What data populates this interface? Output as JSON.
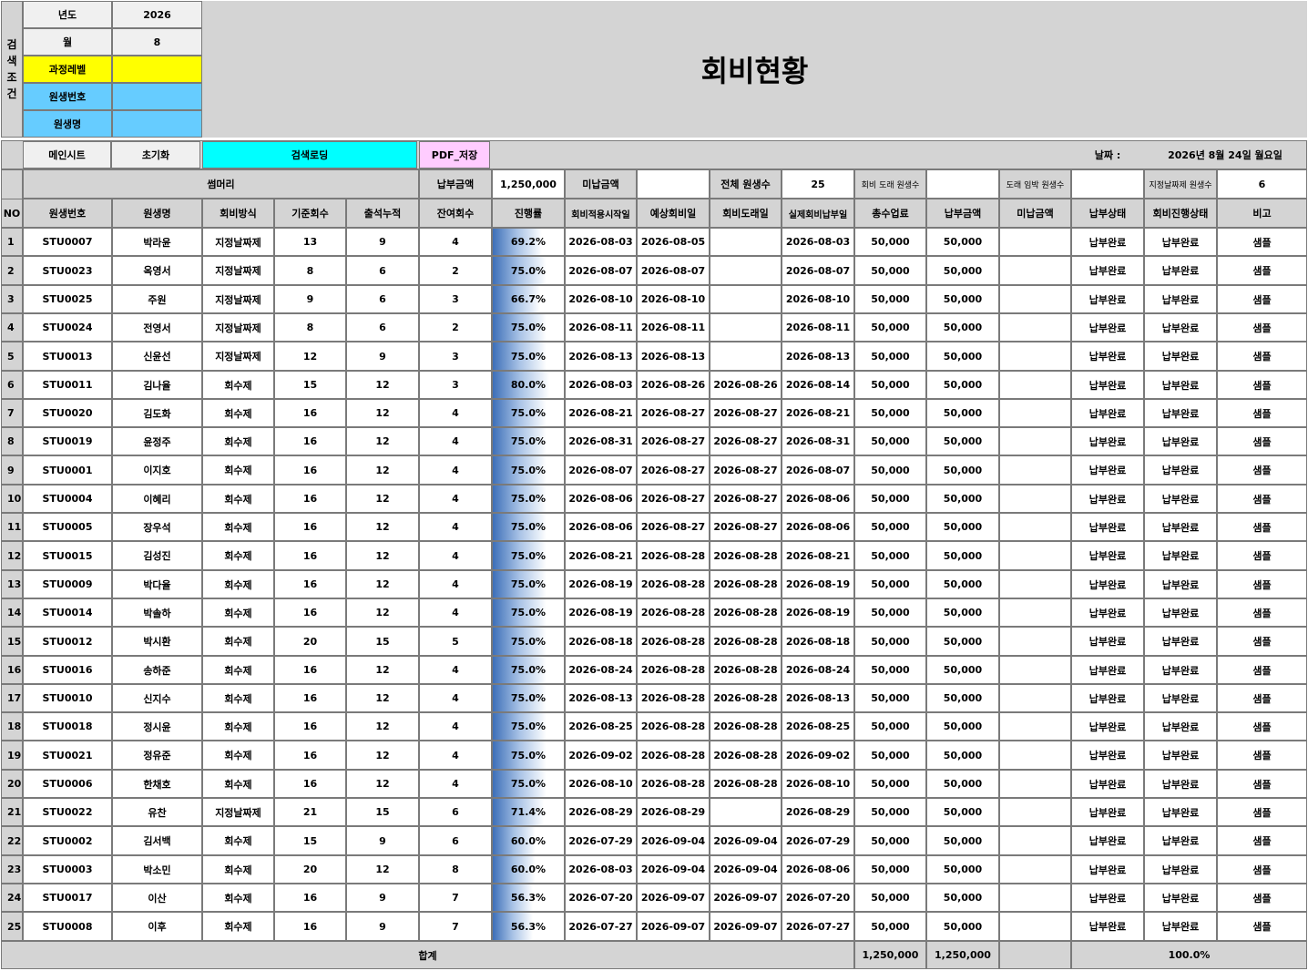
{
  "search": {
    "side_label": "검\n색\n조\n건",
    "year_label": "년도",
    "year_value": "2026",
    "month_label": "월",
    "month_value": "8",
    "level_label": "과정레벨",
    "level_value": "",
    "student_no_label": "원생번호",
    "student_no_value": "",
    "student_name_label": "원생명",
    "student_name_value": ""
  },
  "title": "회비현황",
  "toolbar": {
    "main_sheet": "메인시트",
    "reset": "초기화",
    "search_load": "검색로딩",
    "pdf_save": "PDF_저장",
    "date_label": "날짜 :",
    "date_value": "2026년 8월 24일 월요일"
  },
  "summary": {
    "label": "썸머리",
    "paid_label": "납부금액",
    "paid_value": "1,250,000",
    "unpaid_label": "미납금액",
    "unpaid_value": "",
    "total_students_label": "전체 원생수",
    "total_students_value": "25",
    "due_label": "회비 도래 원생수",
    "due_value": "",
    "near_due_label": "도래 임박 원생수",
    "near_due_value": "",
    "fixed_label": "지정날짜제 원생수",
    "fixed_value": "6"
  },
  "columns": [
    "NO",
    "원생번호",
    "원생명",
    "회비방식",
    "기준회수",
    "출석누적",
    "잔여회수",
    "진행률",
    "회비적용시작일",
    "예상회비일",
    "회비도래일",
    "실제회비납부일",
    "총수업료",
    "납부금액",
    "미납금액",
    "납부상태",
    "회비진행상태",
    "비고"
  ],
  "rows": [
    [
      "1",
      "STU0007",
      "박라윤",
      "지정날짜제",
      "13",
      "9",
      "4",
      "69.2%",
      "2026-08-03",
      "2026-08-05",
      "",
      "2026-08-03",
      "50,000",
      "50,000",
      "",
      "납부완료",
      "납부완료",
      "샘플"
    ],
    [
      "2",
      "STU0023",
      "옥영서",
      "지정날짜제",
      "8",
      "6",
      "2",
      "75.0%",
      "2026-08-07",
      "2026-08-07",
      "",
      "2026-08-07",
      "50,000",
      "50,000",
      "",
      "납부완료",
      "납부완료",
      "샘플"
    ],
    [
      "3",
      "STU0025",
      "주원",
      "지정날짜제",
      "9",
      "6",
      "3",
      "66.7%",
      "2026-08-10",
      "2026-08-10",
      "",
      "2026-08-10",
      "50,000",
      "50,000",
      "",
      "납부완료",
      "납부완료",
      "샘플"
    ],
    [
      "4",
      "STU0024",
      "전영서",
      "지정날짜제",
      "8",
      "6",
      "2",
      "75.0%",
      "2026-08-11",
      "2026-08-11",
      "",
      "2026-08-11",
      "50,000",
      "50,000",
      "",
      "납부완료",
      "납부완료",
      "샘플"
    ],
    [
      "5",
      "STU0013",
      "신윤선",
      "지정날짜제",
      "12",
      "9",
      "3",
      "75.0%",
      "2026-08-13",
      "2026-08-13",
      "",
      "2026-08-13",
      "50,000",
      "50,000",
      "",
      "납부완료",
      "납부완료",
      "샘플"
    ],
    [
      "6",
      "STU0011",
      "김나율",
      "회수제",
      "15",
      "12",
      "3",
      "80.0%",
      "2026-08-03",
      "2026-08-26",
      "2026-08-26",
      "2026-08-14",
      "50,000",
      "50,000",
      "",
      "납부완료",
      "납부완료",
      "샘플"
    ],
    [
      "7",
      "STU0020",
      "김도화",
      "회수제",
      "16",
      "12",
      "4",
      "75.0%",
      "2026-08-21",
      "2026-08-27",
      "2026-08-27",
      "2026-08-21",
      "50,000",
      "50,000",
      "",
      "납부완료",
      "납부완료",
      "샘플"
    ],
    [
      "8",
      "STU0019",
      "윤정주",
      "회수제",
      "16",
      "12",
      "4",
      "75.0%",
      "2026-08-31",
      "2026-08-27",
      "2026-08-27",
      "2026-08-31",
      "50,000",
      "50,000",
      "",
      "납부완료",
      "납부완료",
      "샘플"
    ],
    [
      "9",
      "STU0001",
      "이지호",
      "회수제",
      "16",
      "12",
      "4",
      "75.0%",
      "2026-08-07",
      "2026-08-27",
      "2026-08-27",
      "2026-08-07",
      "50,000",
      "50,000",
      "",
      "납부완료",
      "납부완료",
      "샘플"
    ],
    [
      "10",
      "STU0004",
      "이혜리",
      "회수제",
      "16",
      "12",
      "4",
      "75.0%",
      "2026-08-06",
      "2026-08-27",
      "2026-08-27",
      "2026-08-06",
      "50,000",
      "50,000",
      "",
      "납부완료",
      "납부완료",
      "샘플"
    ],
    [
      "11",
      "STU0005",
      "장우석",
      "회수제",
      "16",
      "12",
      "4",
      "75.0%",
      "2026-08-06",
      "2026-08-27",
      "2026-08-27",
      "2026-08-06",
      "50,000",
      "50,000",
      "",
      "납부완료",
      "납부완료",
      "샘플"
    ],
    [
      "12",
      "STU0015",
      "김성진",
      "회수제",
      "16",
      "12",
      "4",
      "75.0%",
      "2026-08-21",
      "2026-08-28",
      "2026-08-28",
      "2026-08-21",
      "50,000",
      "50,000",
      "",
      "납부완료",
      "납부완료",
      "샘플"
    ],
    [
      "13",
      "STU0009",
      "박다율",
      "회수제",
      "16",
      "12",
      "4",
      "75.0%",
      "2026-08-19",
      "2026-08-28",
      "2026-08-28",
      "2026-08-19",
      "50,000",
      "50,000",
      "",
      "납부완료",
      "납부완료",
      "샘플"
    ],
    [
      "14",
      "STU0014",
      "박솔하",
      "회수제",
      "16",
      "12",
      "4",
      "75.0%",
      "2026-08-19",
      "2026-08-28",
      "2026-08-28",
      "2026-08-19",
      "50,000",
      "50,000",
      "",
      "납부완료",
      "납부완료",
      "샘플"
    ],
    [
      "15",
      "STU0012",
      "박시환",
      "회수제",
      "20",
      "15",
      "5",
      "75.0%",
      "2026-08-18",
      "2026-08-28",
      "2026-08-28",
      "2026-08-18",
      "50,000",
      "50,000",
      "",
      "납부완료",
      "납부완료",
      "샘플"
    ],
    [
      "16",
      "STU0016",
      "송하준",
      "회수제",
      "16",
      "12",
      "4",
      "75.0%",
      "2026-08-24",
      "2026-08-28",
      "2026-08-28",
      "2026-08-24",
      "50,000",
      "50,000",
      "",
      "납부완료",
      "납부완료",
      "샘플"
    ],
    [
      "17",
      "STU0010",
      "신지수",
      "회수제",
      "16",
      "12",
      "4",
      "75.0%",
      "2026-08-13",
      "2026-08-28",
      "2026-08-28",
      "2026-08-13",
      "50,000",
      "50,000",
      "",
      "납부완료",
      "납부완료",
      "샘플"
    ],
    [
      "18",
      "STU0018",
      "정시윤",
      "회수제",
      "16",
      "12",
      "4",
      "75.0%",
      "2026-08-25",
      "2026-08-28",
      "2026-08-28",
      "2026-08-25",
      "50,000",
      "50,000",
      "",
      "납부완료",
      "납부완료",
      "샘플"
    ],
    [
      "19",
      "STU0021",
      "정유준",
      "회수제",
      "16",
      "12",
      "4",
      "75.0%",
      "2026-09-02",
      "2026-08-28",
      "2026-08-28",
      "2026-09-02",
      "50,000",
      "50,000",
      "",
      "납부완료",
      "납부완료",
      "샘플"
    ],
    [
      "20",
      "STU0006",
      "한채호",
      "회수제",
      "16",
      "12",
      "4",
      "75.0%",
      "2026-08-10",
      "2026-08-28",
      "2026-08-28",
      "2026-08-10",
      "50,000",
      "50,000",
      "",
      "납부완료",
      "납부완료",
      "샘플"
    ],
    [
      "21",
      "STU0022",
      "유찬",
      "지정날짜제",
      "21",
      "15",
      "6",
      "71.4%",
      "2026-08-29",
      "2026-08-29",
      "",
      "2026-08-29",
      "50,000",
      "50,000",
      "",
      "납부완료",
      "납부완료",
      "샘플"
    ],
    [
      "22",
      "STU0002",
      "김서백",
      "회수제",
      "15",
      "9",
      "6",
      "60.0%",
      "2026-07-29",
      "2026-09-04",
      "2026-09-04",
      "2026-07-29",
      "50,000",
      "50,000",
      "",
      "납부완료",
      "납부완료",
      "샘플"
    ],
    [
      "23",
      "STU0003",
      "박소민",
      "회수제",
      "20",
      "12",
      "8",
      "60.0%",
      "2026-08-03",
      "2026-09-04",
      "2026-09-04",
      "2026-08-06",
      "50,000",
      "50,000",
      "",
      "납부완료",
      "납부완료",
      "샘플"
    ],
    [
      "24",
      "STU0017",
      "이산",
      "회수제",
      "16",
      "9",
      "7",
      "56.3%",
      "2026-07-20",
      "2026-09-07",
      "2026-09-07",
      "2026-07-20",
      "50,000",
      "50,000",
      "",
      "납부완료",
      "납부완료",
      "샘플"
    ],
    [
      "25",
      "STU0008",
      "이후",
      "회수제",
      "16",
      "9",
      "7",
      "56.3%",
      "2026-07-27",
      "2026-09-07",
      "2026-09-07",
      "2026-07-27",
      "50,000",
      "50,000",
      "",
      "납부완료",
      "납부완료",
      "샘플"
    ]
  ],
  "footer": {
    "total_label": "합계",
    "total_fee": "1,250,000",
    "total_paid": "1,250,000",
    "total_unpaid": "",
    "paid_rate": "100.0%"
  },
  "colors": {
    "header_gray": "#d4d4d4",
    "level_yellow": "#ffff00",
    "field_blue": "#66ccff",
    "load_cyan": "#00ffff",
    "pdf_pink": "#ffccff",
    "progress_blue": "#4f7fc2"
  }
}
